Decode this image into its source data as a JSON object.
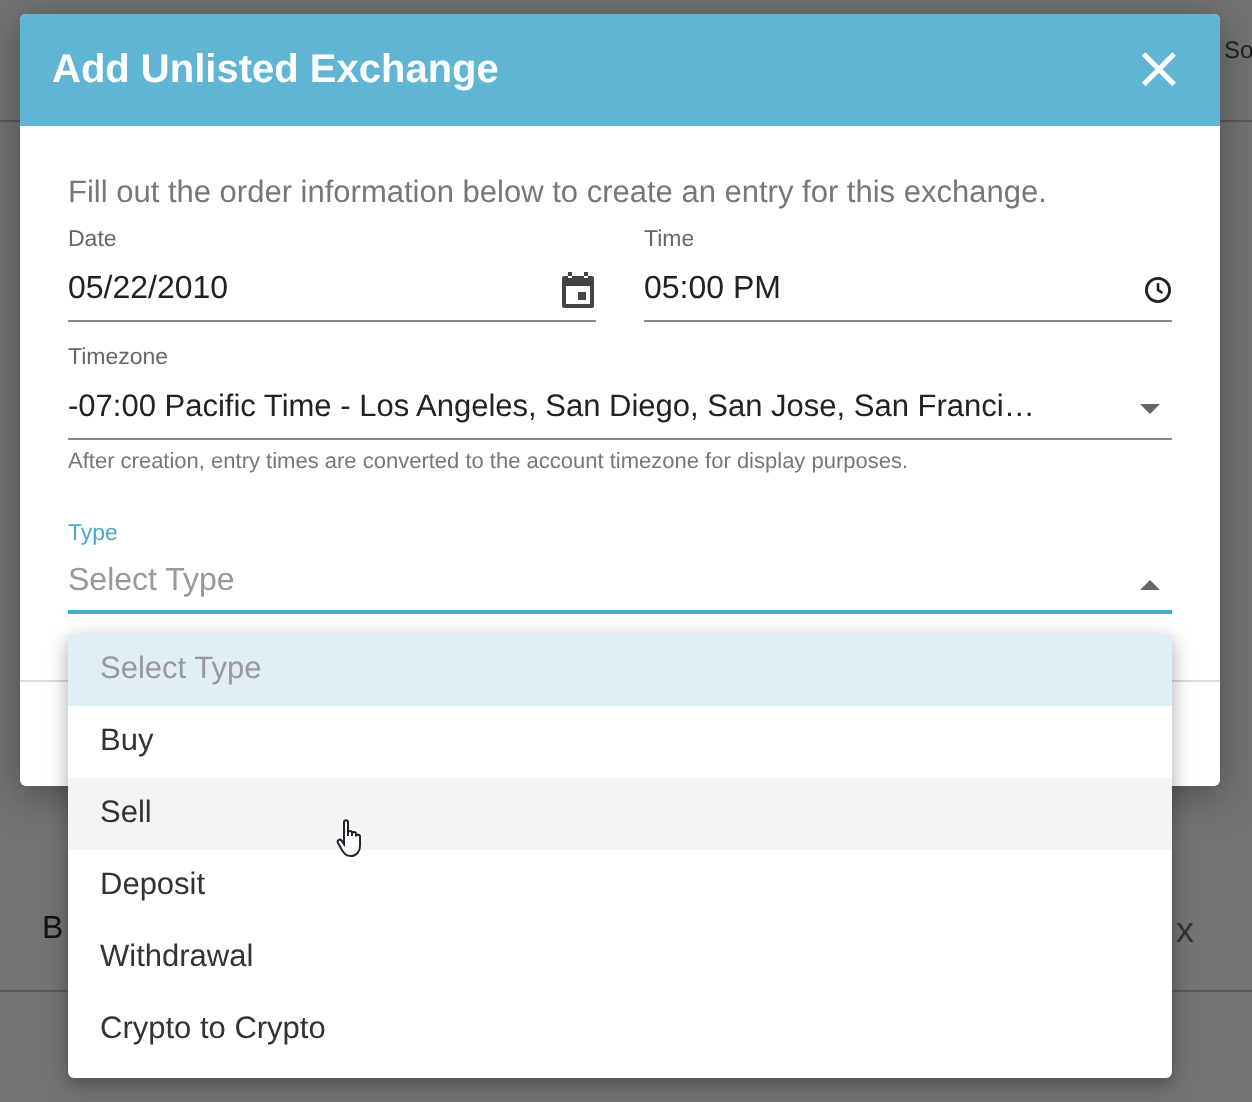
{
  "background": {
    "fragments": [
      {
        "text": "So"
      },
      {
        "text": "B"
      },
      {
        "text": "x"
      }
    ]
  },
  "dialog": {
    "title": "Add Unlisted Exchange",
    "close": "×",
    "intro": "Fill out the order information below to create an entry for this exchange.",
    "date": {
      "label": "Date",
      "value": "05/22/2010"
    },
    "time": {
      "label": "Time",
      "value": "05:00 PM"
    },
    "timezone": {
      "label": "Timezone",
      "value": "-07:00 Pacific Time - Los Angeles, San Diego, San Jose, San Franci…",
      "hint": "After creation, entry times are converted to the account timezone for display purposes."
    },
    "type": {
      "label": "Type",
      "placeholder": "Select Type",
      "expanded": true,
      "options": [
        {
          "label": "Select Type",
          "selected": true,
          "hovered": false
        },
        {
          "label": "Buy",
          "selected": false,
          "hovered": false
        },
        {
          "label": "Sell",
          "selected": false,
          "hovered": true
        },
        {
          "label": "Deposit",
          "selected": false,
          "hovered": false
        },
        {
          "label": "Withdrawal",
          "selected": false,
          "hovered": false
        },
        {
          "label": "Crypto to Crypto",
          "selected": false,
          "hovered": false
        }
      ]
    }
  }
}
